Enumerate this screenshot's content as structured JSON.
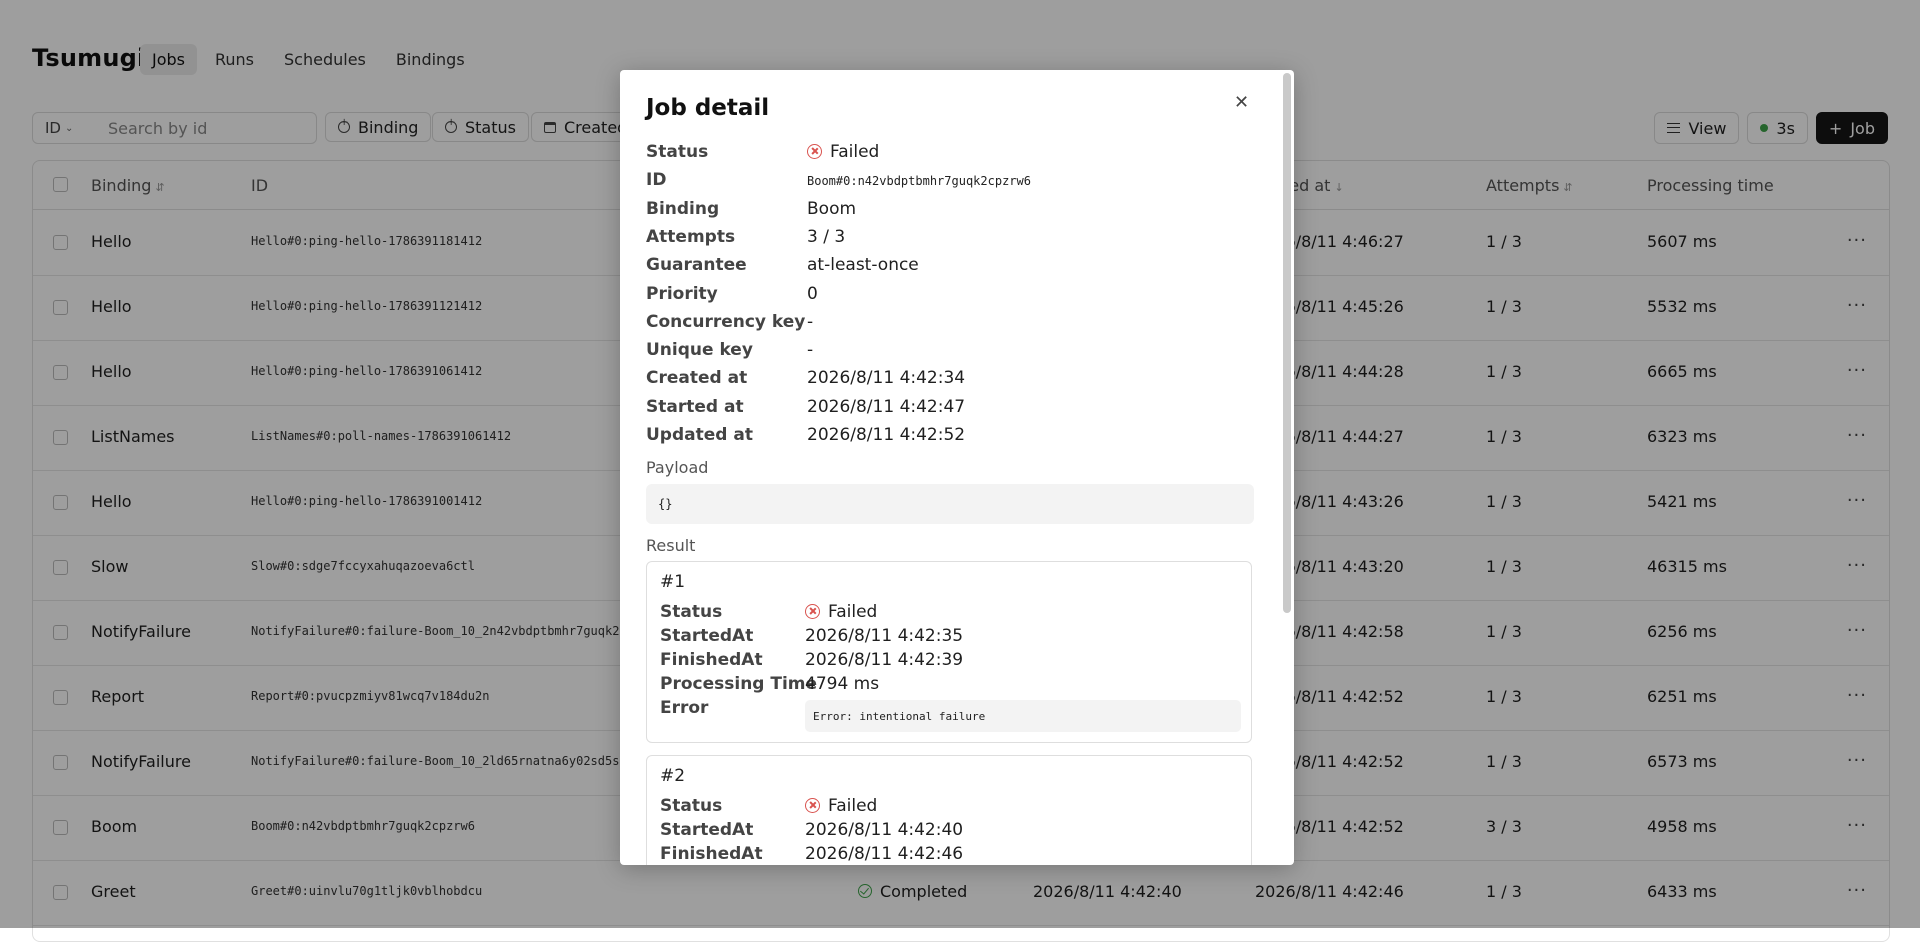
{
  "app": {
    "brand": "Tsumugi",
    "nav": [
      "Jobs",
      "Runs",
      "Schedules",
      "Bindings"
    ],
    "active_nav": "Jobs"
  },
  "toolbar": {
    "id_select": "ID",
    "search_placeholder": "Search by id",
    "filters": [
      "Binding",
      "Status",
      "Created"
    ],
    "view_label": "View",
    "refresh_label": "3s",
    "new_job_label": "Job"
  },
  "table": {
    "headers": [
      "Binding",
      "ID",
      "ted at",
      "Attempts",
      "Processing time"
    ],
    "rows": [
      {
        "binding": "Hello",
        "id": "Hello#0:ping-hello-1786391181412",
        "status": "",
        "created": "",
        "updated": "2026/8/11 4:46:27",
        "attempts": "1 / 3",
        "time": "5607 ms"
      },
      {
        "binding": "Hello",
        "id": "Hello#0:ping-hello-1786391121412",
        "status": "",
        "created": "",
        "updated": "2026/8/11 4:45:26",
        "attempts": "1 / 3",
        "time": "5532 ms"
      },
      {
        "binding": "Hello",
        "id": "Hello#0:ping-hello-1786391061412",
        "status": "",
        "created": "",
        "updated": "2026/8/11 4:44:28",
        "attempts": "1 / 3",
        "time": "6665 ms"
      },
      {
        "binding": "ListNames",
        "id": "ListNames#0:poll-names-1786391061412",
        "status": "",
        "created": "",
        "updated": "2026/8/11 4:44:27",
        "attempts": "1 / 3",
        "time": "6323 ms"
      },
      {
        "binding": "Hello",
        "id": "Hello#0:ping-hello-1786391001412",
        "status": "",
        "created": "",
        "updated": "2026/8/11 4:43:26",
        "attempts": "1 / 3",
        "time": "5421 ms"
      },
      {
        "binding": "Slow",
        "id": "Slow#0:sdge7fccyxahuqazoeva6ctl",
        "status": "",
        "created": "",
        "updated": "2026/8/11 4:43:20",
        "attempts": "1 / 3",
        "time": "46315 ms"
      },
      {
        "binding": "NotifyFailure",
        "id": "NotifyFailure#0:failure-Boom_10_2n42vbdptbmhr7guqk2",
        "status": "",
        "created": "",
        "updated": "2026/8/11 4:42:58",
        "attempts": "1 / 3",
        "time": "6256 ms"
      },
      {
        "binding": "Report",
        "id": "Report#0:pvucpzmiyv81wcq7v184du2n",
        "status": "",
        "created": "",
        "updated": "2026/8/11 4:42:52",
        "attempts": "1 / 3",
        "time": "6251 ms"
      },
      {
        "binding": "NotifyFailure",
        "id": "NotifyFailure#0:failure-Boom_10_2ld65rnatna6y02sd5s",
        "status": "",
        "created": "",
        "updated": "2026/8/11 4:42:52",
        "attempts": "1 / 3",
        "time": "6573 ms"
      },
      {
        "binding": "Boom",
        "id": "Boom#0:n42vbdptbmhr7guqk2cpzrw6",
        "status": "",
        "created": "",
        "updated": "2026/8/11 4:42:52",
        "attempts": "3 / 3",
        "time": "4958 ms"
      },
      {
        "binding": "Greet",
        "id": "Greet#0:uinvlu70g1tljk0vblhobdcu",
        "status": "Completed",
        "created": "2026/8/11 4:42:40",
        "updated": "2026/8/11 4:42:46",
        "attempts": "1 / 3",
        "time": "6433 ms"
      }
    ]
  },
  "modal": {
    "title": "Job detail",
    "fields": [
      {
        "label": "Status",
        "value": "Failed"
      },
      {
        "label": "ID",
        "value": "Boom#0:n42vbdptbmhr7guqk2cpzrw6"
      },
      {
        "label": "Binding",
        "value": "Boom"
      },
      {
        "label": "Attempts",
        "value": "3 / 3"
      },
      {
        "label": "Guarantee",
        "value": "at-least-once"
      },
      {
        "label": "Priority",
        "value": "0"
      },
      {
        "label": "Concurrency key",
        "value": "-"
      },
      {
        "label": "Unique key",
        "value": "-"
      },
      {
        "label": "Created at",
        "value": "2026/8/11 4:42:34"
      },
      {
        "label": "Started at",
        "value": "2026/8/11 4:42:47"
      },
      {
        "label": "Updated at",
        "value": "2026/8/11 4:42:52"
      }
    ],
    "payload_label": "Payload",
    "payload": "{}",
    "result_label": "Result",
    "results": [
      {
        "num": "#1",
        "status_label": "Status",
        "status": "Failed",
        "started_label": "StartedAt",
        "started": "2026/8/11 4:42:35",
        "finished_label": "FinishedAt",
        "finished": "2026/8/11 4:42:39",
        "ptime_label": "Processing Time",
        "ptime": "4794 ms",
        "error_label": "Error",
        "error": "Error: intentional failure"
      },
      {
        "num": "#2",
        "status_label": "Status",
        "status": "Failed",
        "started_label": "StartedAt",
        "started": "2026/8/11 4:42:40",
        "finished_label": "FinishedAt",
        "finished": "2026/8/11 4:42:46"
      }
    ]
  }
}
